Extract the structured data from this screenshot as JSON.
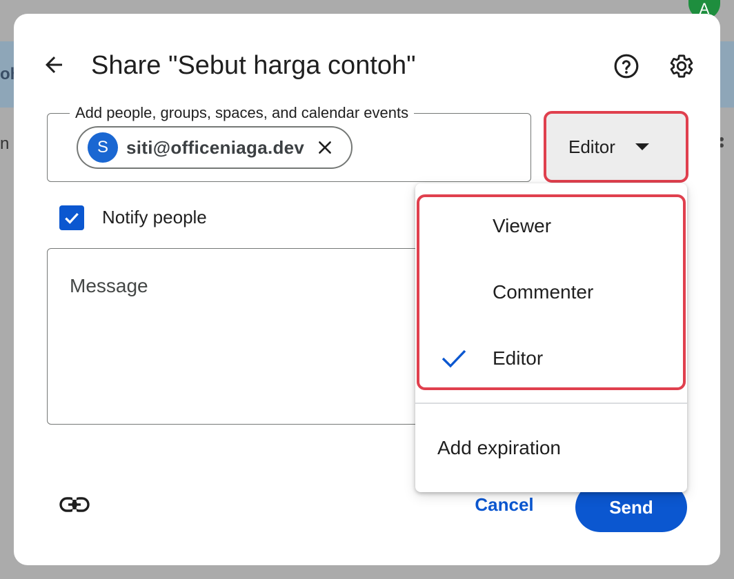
{
  "background": {
    "avatar_letter": "A",
    "left_fragment_1": "oh",
    "left_fragment_2": "n c"
  },
  "dialog": {
    "title": "Share \"Sebut harga contoh\"",
    "people_field_label": "Add people, groups, spaces, and calendar events",
    "chip": {
      "avatar_letter": "S",
      "email": "siti@officeniaga.dev"
    },
    "role_button_label": "Editor",
    "notify_label": "Notify people",
    "notify_checked": true,
    "message_placeholder": "Message",
    "cancel_label": "Cancel",
    "send_label": "Send"
  },
  "role_menu": {
    "items": [
      {
        "label": "Viewer",
        "selected": false
      },
      {
        "label": "Commenter",
        "selected": false
      },
      {
        "label": "Editor",
        "selected": true
      }
    ],
    "add_expiration_label": "Add expiration"
  },
  "colors": {
    "primary": "#0b57d0",
    "highlight": "#e0404e",
    "chip_avatar": "#1a67d2"
  },
  "icons": {
    "back": "arrow-back-icon",
    "help": "help-circle-icon",
    "settings": "gear-icon",
    "chip_remove": "close-icon",
    "caret": "caret-down-icon",
    "check": "checkmark-icon",
    "link": "link-icon"
  }
}
